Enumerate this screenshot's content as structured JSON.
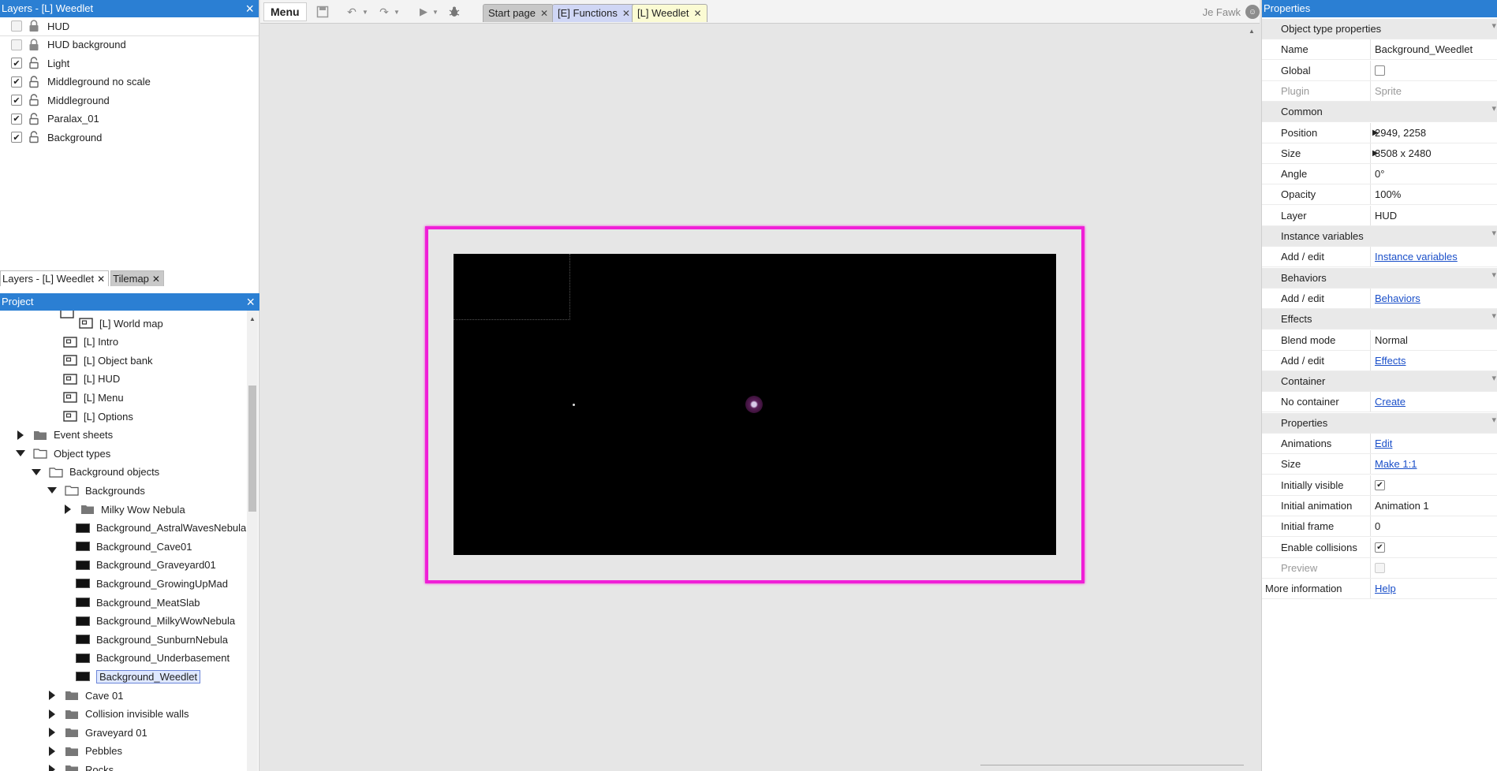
{
  "layers_panel": {
    "title": "Layers - [L] Weedlet",
    "items": [
      {
        "label": "HUD",
        "checked": false,
        "locked": true
      },
      {
        "label": "HUD background",
        "checked": false,
        "locked": true
      },
      {
        "label": "Light",
        "checked": true,
        "locked": false
      },
      {
        "label": "Middleground no scale",
        "checked": true,
        "locked": false
      },
      {
        "label": "Middleground",
        "checked": true,
        "locked": false
      },
      {
        "label": "Paralax_01",
        "checked": true,
        "locked": false
      },
      {
        "label": "Background",
        "checked": true,
        "locked": false
      }
    ],
    "tabs": [
      {
        "label": "Layers - [L] Weedlet"
      },
      {
        "label": "Tilemap"
      }
    ]
  },
  "project_panel": {
    "title": "Project",
    "tree": [
      {
        "label": "[L] World map",
        "type": "layout"
      },
      {
        "label": "[L] Intro",
        "type": "layout"
      },
      {
        "label": "[L] Object bank",
        "type": "layout"
      },
      {
        "label": "[L] HUD",
        "type": "layout"
      },
      {
        "label": "[L] Menu",
        "type": "layout"
      },
      {
        "label": "[L] Options",
        "type": "layout"
      },
      {
        "label": "Event sheets",
        "type": "folder"
      },
      {
        "label": "Object types",
        "type": "folder"
      },
      {
        "label": "Background objects",
        "type": "folder"
      },
      {
        "label": "Backgrounds",
        "type": "folder"
      },
      {
        "label": "Milky Wow Nebula",
        "type": "folder"
      },
      {
        "label": "Background_AstralWavesNebula",
        "type": "sprite"
      },
      {
        "label": "Background_Cave01",
        "type": "sprite"
      },
      {
        "label": "Background_Graveyard01",
        "type": "sprite"
      },
      {
        "label": "Background_GrowingUpMad",
        "type": "sprite"
      },
      {
        "label": "Background_MeatSlab",
        "type": "sprite"
      },
      {
        "label": "Background_MilkyWowNebula",
        "type": "sprite"
      },
      {
        "label": "Background_SunburnNebula",
        "type": "sprite"
      },
      {
        "label": "Background_Underbasement",
        "type": "sprite"
      },
      {
        "label": "Background_Weedlet",
        "type": "sprite"
      },
      {
        "label": "Cave 01",
        "type": "folder"
      },
      {
        "label": "Collision invisible walls",
        "type": "folder"
      },
      {
        "label": "Graveyard 01",
        "type": "folder"
      },
      {
        "label": "Pebbles",
        "type": "folder"
      },
      {
        "label": "Rocks",
        "type": "folder"
      }
    ]
  },
  "toolbar": {
    "menu_label": "Menu",
    "tabs": [
      {
        "label": "Start page",
        "bg": "#c8c8c8"
      },
      {
        "label": "[E] Functions",
        "bg": "#cfd6f5"
      },
      {
        "label": "[L] Weedlet",
        "bg": "#fbfbd3"
      }
    ],
    "user_name": "Je Fawk"
  },
  "properties_panel": {
    "title": "Properties",
    "rows": {
      "object_type_properties": "Object type properties",
      "name_key": "Name",
      "name_val": "Background_Weedlet",
      "global_key": "Global",
      "plugin_key": "Plugin",
      "plugin_val": "Sprite",
      "common": "Common",
      "position_key": "Position",
      "position_val": "2949, 2258",
      "size_key": "Size",
      "size_val": "3508 x 2480",
      "angle_key": "Angle",
      "angle_val": "0°",
      "opacity_key": "Opacity",
      "opacity_val": "100%",
      "layer_key": "Layer",
      "layer_val": "HUD",
      "instance_variables": "Instance variables",
      "iv_key": "Add / edit",
      "iv_val": "Instance variables",
      "behaviors": "Behaviors",
      "bh_key": "Add / edit",
      "bh_val": "Behaviors",
      "effects": "Effects",
      "blend_key": "Blend mode",
      "blend_val": "Normal",
      "fx_key": "Add / edit",
      "fx_val": "Effects",
      "container": "Container",
      "container_key": "No container",
      "container_val": "Create",
      "properties": "Properties",
      "anims_key": "Animations",
      "anims_val": "Edit",
      "size2_key": "Size",
      "size2_val": "Make 1:1",
      "visible_key": "Initially visible",
      "initanim_key": "Initial animation",
      "initanim_val": "Animation 1",
      "initframe_key": "Initial frame",
      "initframe_val": "0",
      "collisions_key": "Enable collisions",
      "preview_key": "Preview",
      "more_key": "More information",
      "more_val": "Help"
    }
  },
  "colors": {
    "accent": "#2b7fd3",
    "layout_border": "#f01fd7"
  }
}
